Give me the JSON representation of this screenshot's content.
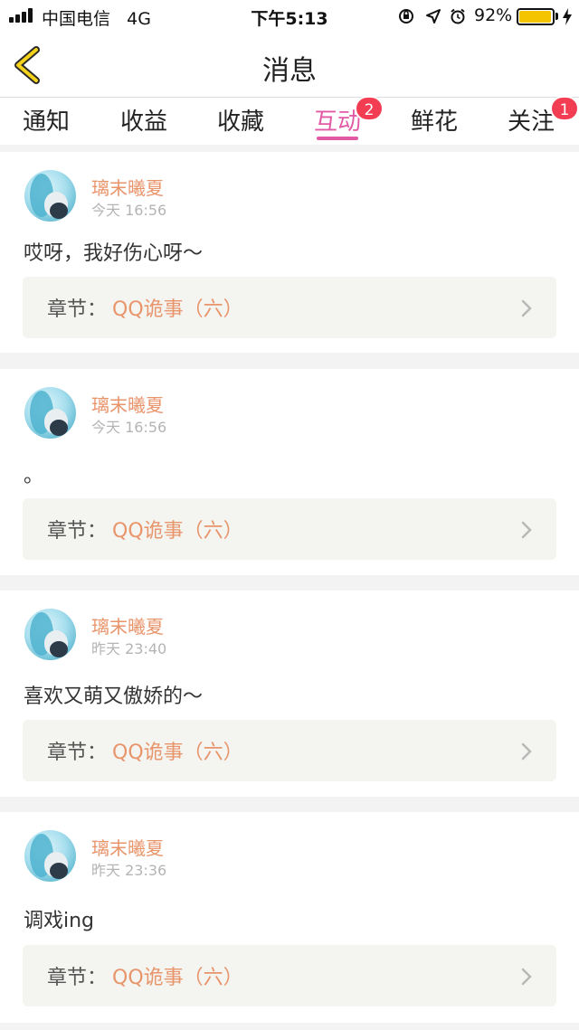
{
  "status_bar": {
    "carrier": "中国电信",
    "network": "4G",
    "time": "下午5:13",
    "battery_percent": "92%",
    "battery_level": 0.92,
    "icons": [
      "signal-icon",
      "orientation-lock-icon",
      "location-icon",
      "alarm-icon",
      "battery-icon",
      "charging-icon"
    ]
  },
  "nav": {
    "title": "消息",
    "back_icon": "chevron-left-icon"
  },
  "tabs": [
    {
      "label": "通知",
      "badge": ""
    },
    {
      "label": "收益",
      "badge": ""
    },
    {
      "label": "收藏",
      "badge": ""
    },
    {
      "label": "互动",
      "badge": "2",
      "active": true
    },
    {
      "label": "鲜花",
      "badge": ""
    },
    {
      "label": "关注",
      "badge": "1"
    }
  ],
  "messages": [
    {
      "user": "璃末曦夏",
      "time": "今天 16:56",
      "text": "哎呀，我好伤心呀～",
      "chapter_label": "章节：",
      "chapter": "QQ诡事（六）"
    },
    {
      "user": "璃末曦夏",
      "time": "今天 16:56",
      "text": "。",
      "chapter_label": "章节：",
      "chapter": "QQ诡事（六）"
    },
    {
      "user": "璃末曦夏",
      "time": "昨天 23:40",
      "text": "喜欢又萌又傲娇的～",
      "chapter_label": "章节：",
      "chapter": "QQ诡事（六）"
    },
    {
      "user": "璃末曦夏",
      "time": "昨天 23:36",
      "text": "调戏ing",
      "chapter_label": "章节：",
      "chapter": "QQ诡事（六）"
    }
  ],
  "colors": {
    "accent": "#e25aa6",
    "badge": "#f23d52",
    "username": "#e8956c",
    "battery": "#f4c400"
  }
}
